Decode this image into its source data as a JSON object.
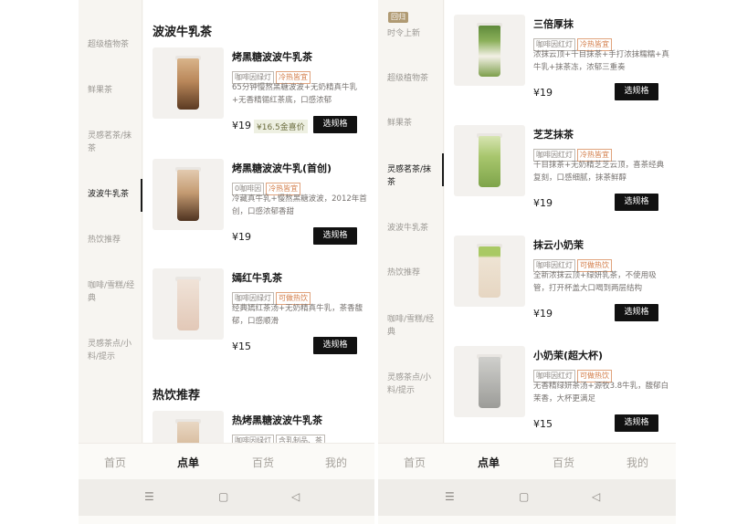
{
  "left": {
    "sidebar": [
      {
        "label": "超级植物茶",
        "active": false
      },
      {
        "label": "鲜果茶",
        "active": false
      },
      {
        "label": "灵感茗茶/抹茶",
        "active": false
      },
      {
        "label": "波波牛乳茶",
        "active": true
      },
      {
        "label": "热饮推荐",
        "active": false
      },
      {
        "label": "咖啡/雪糕/经典",
        "active": false
      },
      {
        "label": "灵感茶点/小料/提示",
        "active": false
      }
    ],
    "section_title": "波波牛乳茶",
    "section2_title": "热饮推荐",
    "products": [
      {
        "name": "烤黑糖波波牛乳茶",
        "tags": [
          "咖啡因绿灯",
          "冷热皆宜"
        ],
        "desc": "65分钟慢熬黑糖波波+无奶精真牛乳+无香精锡红茶底，口感浓郁",
        "price": "¥19",
        "member_price": "¥16.5金喜价",
        "button": "选规格"
      },
      {
        "name": "烤黑糖波波牛乳(首创)",
        "tags": [
          "0咖啡因",
          "冷热皆宜"
        ],
        "desc": "冷藏真牛乳+慢熬黑糖波波，2012年首创，口感浓郁香甜",
        "price": "¥19",
        "button": "选规格"
      },
      {
        "name": "嫣红牛乳茶",
        "tags": [
          "咖啡因绿灯",
          "可做热饮"
        ],
        "desc": "经典嫣红茶汤+无奶精真牛乳，茶香馥郁，口感顺滑",
        "price": "¥15",
        "button": "选规格"
      },
      {
        "name": "热烤黑糖波波牛乳茶",
        "tags": [
          "咖啡因绿灯",
          "含乳制品、茶"
        ]
      }
    ],
    "tabs": [
      "首页",
      "点单",
      "百货",
      "我的"
    ]
  },
  "right": {
    "badge": "回归",
    "sidebar": [
      {
        "label": "时令上新",
        "active": false
      },
      {
        "label": "超级植物茶",
        "active": false
      },
      {
        "label": "鲜果茶",
        "active": false
      },
      {
        "label": "灵感茗茶/抹茶",
        "active": true
      },
      {
        "label": "波波牛乳茶",
        "active": false
      },
      {
        "label": "热饮推荐",
        "active": false
      },
      {
        "label": "咖啡/雪糕/经典",
        "active": false
      },
      {
        "label": "灵感茶点/小料/提示",
        "active": false
      }
    ],
    "products": [
      {
        "name": "三倍厚抹",
        "tags": [
          "咖啡因红灯",
          "冷热皆宜"
        ],
        "desc": "浓抹云顶+千目抹茶+手打浓抹糯糯+真牛乳+抹茶冻，浓郁三重奏",
        "price": "¥19",
        "button": "选规格"
      },
      {
        "name": "芝芝抹茶",
        "tags": [
          "咖啡因红灯",
          "冷热皆宜"
        ],
        "desc": "千目抹茶+无奶精芝芝云顶，喜茶经典复刻，口感细腻，抹茶鲜醇",
        "price": "¥19",
        "button": "选规格"
      },
      {
        "name": "抹云小奶茉",
        "tags": [
          "咖啡因红灯",
          "可做热饮"
        ],
        "desc": "全新浓抹云顶+绿妍乳茶，不使用吸管，打开杯盖大口喝到两层结构",
        "price": "¥19",
        "button": "选规格"
      },
      {
        "name": "小奶茉(超大杯)",
        "tags": [
          "咖啡因红灯",
          "可做热饮"
        ],
        "desc": "无香精绿妍茶汤+源牧3.8牛乳，馥郁白茉香，大杯更满足",
        "price": "¥15",
        "button": "选规格"
      }
    ],
    "tabs": [
      "首页",
      "点单",
      "百货",
      "我的"
    ]
  },
  "nav_icons": [
    "menu-icon",
    "home-square-icon",
    "back-triangle-icon"
  ]
}
